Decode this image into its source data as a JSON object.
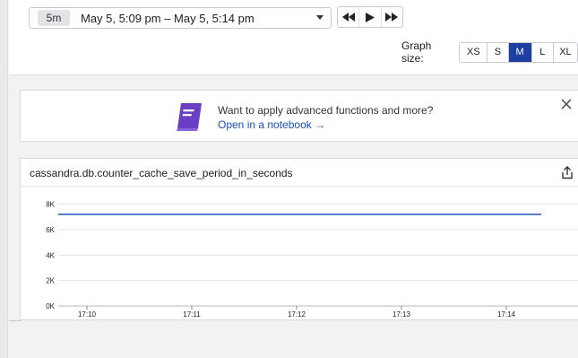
{
  "time_picker": {
    "duration": "5m",
    "range": "May 5, 5:09 pm – May 5, 5:14 pm"
  },
  "graph_size": {
    "label": "Graph size:",
    "options": [
      "XS",
      "S",
      "M",
      "L",
      "XL"
    ],
    "selected": "M"
  },
  "banner": {
    "title": "Want to apply advanced functions and more?",
    "link": "Open in a notebook →"
  },
  "widget": {
    "title": "cassandra.db.counter_cache_save_period_in_seconds"
  },
  "colors": {
    "accent": "#1f3fa0",
    "series": "#3b6cc0",
    "notebook_icon": "#6b3fc4"
  },
  "icons": {
    "rewind": "rewind-icon",
    "play": "play-icon",
    "fast_forward": "fast-forward-icon",
    "notebook": "notebook-icon",
    "close": "close-icon",
    "share": "share-icon",
    "caret": "chevron-down-icon"
  },
  "chart_data": {
    "type": "line",
    "title": "cassandra.db.counter_cache_save_period_in_seconds",
    "xlabel": "",
    "ylabel": "",
    "x_ticks": [
      "17:10",
      "17:11",
      "17:12",
      "17:13",
      "17:14"
    ],
    "y_ticks": [
      "0K",
      "2K",
      "4K",
      "6K",
      "8K"
    ],
    "ylim": [
      0,
      8600
    ],
    "grid": true,
    "series": [
      {
        "x": [
          "17:09:30",
          "17:10",
          "17:11",
          "17:12",
          "17:13",
          "17:14",
          "17:14:20"
        ],
        "values": [
          7200,
          7200,
          7200,
          7200,
          7200,
          7200,
          7200
        ]
      }
    ]
  }
}
